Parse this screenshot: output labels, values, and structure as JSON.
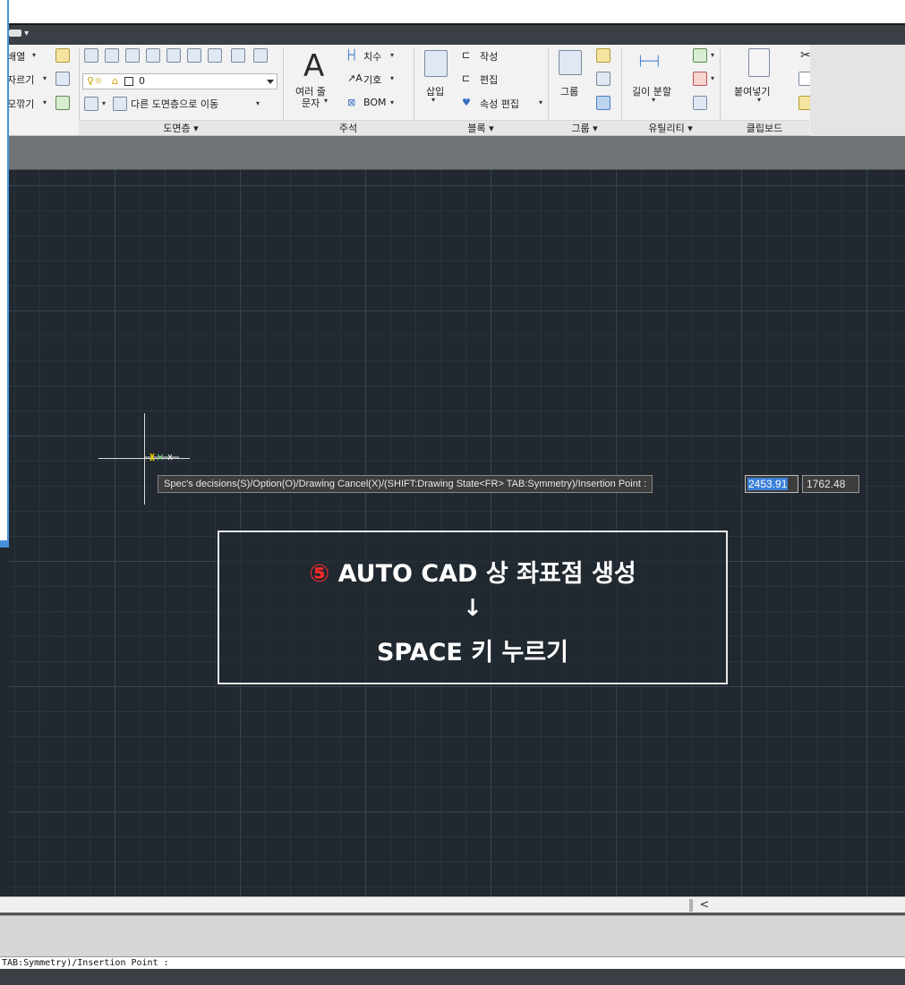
{
  "ribbon": {
    "draw_partial": [
      "배열",
      "자르기",
      "모깎기"
    ],
    "layer_combo_value": "0",
    "layer_move_label": "다른 도면층으로 이동",
    "panels": {
      "layers": "도면층 ▾",
      "annotation": "주석",
      "block": "블록 ▾",
      "group": "그룹 ▾",
      "utilities": "유틸리티 ▾",
      "clipboard": "클립보드"
    },
    "annotation": {
      "multiline_text_l1": "여러 줄",
      "multiline_text_l2": "문자",
      "dimension": "치수",
      "leader": "기호",
      "bom": "BOM"
    },
    "block": {
      "insert": "삽입",
      "create": "작성",
      "edit": "편집",
      "edit_attributes": "속성 편집"
    },
    "group": {
      "group": "그룹"
    },
    "utilities": {
      "measure": "길이 분할"
    },
    "clipboard": {
      "paste": "붙여넣기"
    }
  },
  "canvas": {
    "prompt": "Spec's decisions(S)/Option(O)/Drawing Cancel(X)/(SHIFT:Drawing State<FR> TAB:Symmetry)/Insertion Point :",
    "coord_x": "2453.91",
    "coord_y": "1762.48"
  },
  "callout": {
    "number": "⑤",
    "line1": "AUTO CAD 상 좌표점 생성",
    "arrow": "↓",
    "line3": "SPACE 키 누르기"
  },
  "scrollbar": {
    "left_arrow": "<"
  },
  "command_line": {
    "text": "TAB:Symmetry)/Insertion Point :"
  },
  "colors": {
    "canvas_bg": "#212830",
    "highlight": "#3a7fd8",
    "callout_number": "#ff2a2a",
    "panel_outline": "#4a90d9"
  }
}
